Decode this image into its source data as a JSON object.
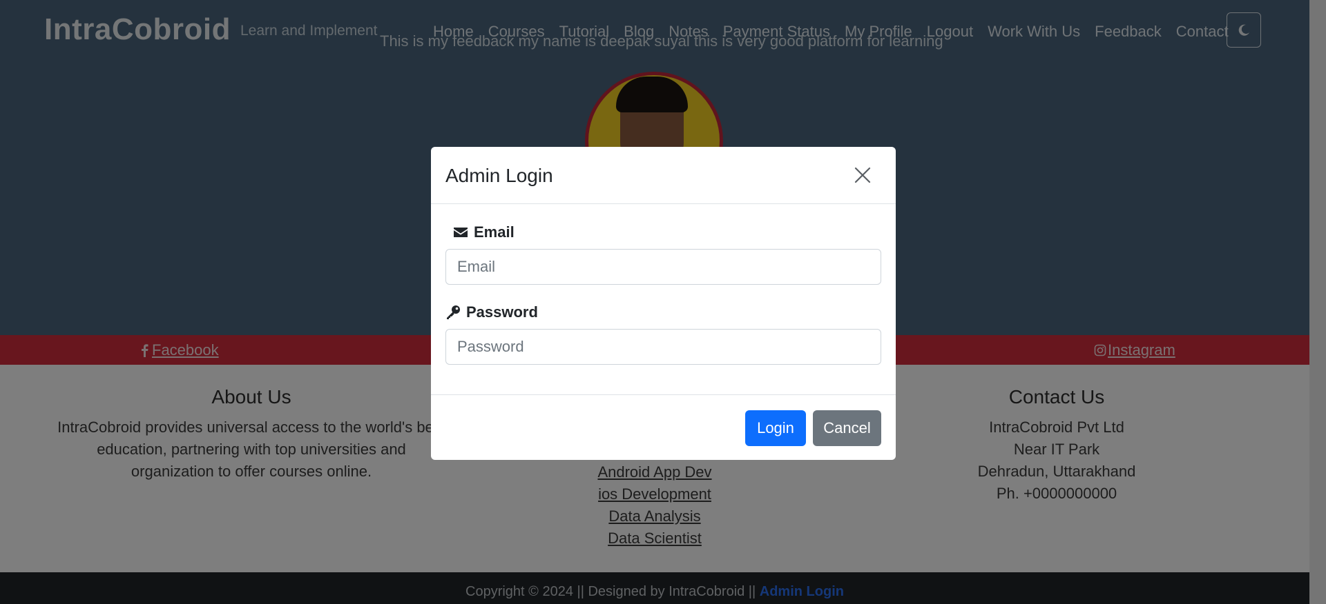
{
  "header": {
    "brand": "IntraCobroid",
    "tagline": "Learn and Implement",
    "nav": [
      "Home",
      "Courses",
      "Tutorial",
      "Blog",
      "Notes",
      "Payment Status",
      "My Profile",
      "Logout",
      "Work With Us",
      "Feedback",
      "Contact"
    ],
    "theme_icon": "moon-icon"
  },
  "hero": {
    "feedback_text": "This is my feedback my name is deepak suyal this is very good platform for learning"
  },
  "social": {
    "facebook": "Facebook",
    "instagram": "Instagram"
  },
  "footer": {
    "about": {
      "title": "About Us",
      "lines": [
        "IntraCobroid provides universal access to the world's best",
        "education, partnering with top universities and",
        "organization to offer courses online."
      ]
    },
    "links": [
      "Android App Dev",
      "ios Development",
      "Data Analysis",
      "Data Scientist"
    ],
    "contact": {
      "title": "Contact Us",
      "lines": [
        "IntraCobroid Pvt Ltd",
        "Near IT Park",
        "Dehradun, Uttarakhand",
        "Ph. +0000000000"
      ]
    },
    "copyright": "Copyright © 2024 || Designed by IntraCobroid || ",
    "admin_link": "Admin Login"
  },
  "modal": {
    "title": "Admin Login",
    "email_label": "Email",
    "email_placeholder": "Email",
    "password_label": "Password",
    "password_placeholder": "Password",
    "login_button": "Login",
    "cancel_button": "Cancel"
  }
}
